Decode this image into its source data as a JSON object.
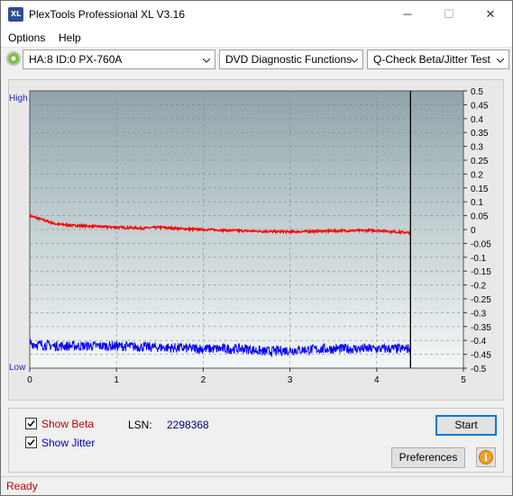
{
  "window": {
    "app_icon_text": "XL",
    "title": "PlexTools Professional XL V3.16",
    "minimize_glyph": "─",
    "maximize_glyph": "☐",
    "close_glyph": "✕"
  },
  "menu": {
    "options": "Options",
    "help": "Help"
  },
  "toolbar": {
    "drive": "HA:8 ID:0  PX-760A",
    "function": "DVD Diagnostic Functions",
    "test": "Q-Check Beta/Jitter Test"
  },
  "chart_data": {
    "type": "line",
    "ylabel_top": "High",
    "ylabel_bottom": "Low",
    "xlim": [
      0,
      5
    ],
    "x_ticks": [
      "0",
      "1",
      "2",
      "3",
      "4",
      "5"
    ],
    "ylim": [
      -0.5,
      0.5
    ],
    "y_ticks": [
      "0.5",
      "0.45",
      "0.4",
      "0.35",
      "0.3",
      "0.25",
      "0.2",
      "0.15",
      "0.1",
      "0.05",
      "0",
      "-0.05",
      "-0.1",
      "-0.15",
      "-0.2",
      "-0.25",
      "-0.3",
      "-0.35",
      "-0.4",
      "-0.45",
      "-0.5"
    ],
    "end_marker_x": 4.39,
    "grid": true,
    "series": [
      {
        "name": "Beta",
        "color": "#ff0000",
        "x": [
          0,
          0.1,
          0.2,
          0.3,
          0.5,
          0.7,
          1.0,
          1.3,
          1.5,
          1.8,
          2.0,
          2.5,
          3.0,
          3.5,
          4.0,
          4.39
        ],
        "y": [
          0.05,
          0.04,
          0.03,
          0.02,
          0.015,
          0.012,
          0.008,
          0.005,
          0.008,
          0.002,
          0.0,
          -0.005,
          -0.008,
          -0.005,
          -0.003,
          -0.012
        ]
      },
      {
        "name": "Jitter",
        "color": "#0000ff",
        "x": [
          0,
          0.1,
          0.3,
          0.5,
          1.0,
          1.5,
          2.0,
          2.5,
          2.7,
          3.0,
          3.5,
          4.0,
          4.39
        ],
        "y": [
          -0.41,
          -0.415,
          -0.42,
          -0.42,
          -0.42,
          -0.425,
          -0.43,
          -0.43,
          -0.44,
          -0.435,
          -0.43,
          -0.43,
          -0.43
        ]
      }
    ]
  },
  "controls": {
    "show_beta": "Show Beta",
    "show_beta_checked": true,
    "show_jitter": "Show Jitter",
    "show_jitter_checked": true,
    "lsn_label": "LSN:",
    "lsn_value": "2298368",
    "start": "Start",
    "preferences": "Preferences",
    "info_glyph": "i"
  },
  "colors": {
    "beta_label": "#c00000",
    "jitter_label": "#0000c0",
    "lsn_value": "#00007f",
    "status_text": "#c00000"
  },
  "status": {
    "text": "Ready"
  }
}
